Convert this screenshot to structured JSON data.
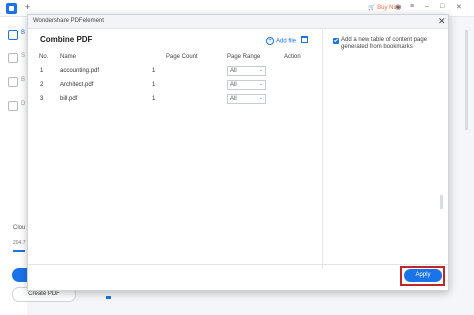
{
  "app": {
    "buy_now": "Buy Now",
    "sidebar_letters": [
      "B",
      "S",
      "B",
      "D"
    ],
    "cloud_label": "Clou",
    "cloud_usage": "204.7",
    "create_pdf": "Create PDF"
  },
  "dialog": {
    "window_title": "Wondershare PDFelement",
    "panel_title": "Combine PDF",
    "add_file": "Add file",
    "columns": [
      "No.",
      "Name",
      "Page Count",
      "Page Range",
      "Action"
    ],
    "rows": [
      {
        "no": "1",
        "name": "accounting.pdf",
        "page_count": "1",
        "page_range": "All"
      },
      {
        "no": "2",
        "name": "Architect.pdf",
        "page_count": "1",
        "page_range": "All"
      },
      {
        "no": "3",
        "name": "bill.pdf",
        "page_count": "1",
        "page_range": "All"
      }
    ],
    "option_label": "Add a new table of content page generated from bookmarks",
    "option_checked": true,
    "apply": "Apply"
  },
  "colors": {
    "accent": "#1a73e8",
    "buy_now": "#ff6b3d",
    "highlight": "#c0262d"
  }
}
